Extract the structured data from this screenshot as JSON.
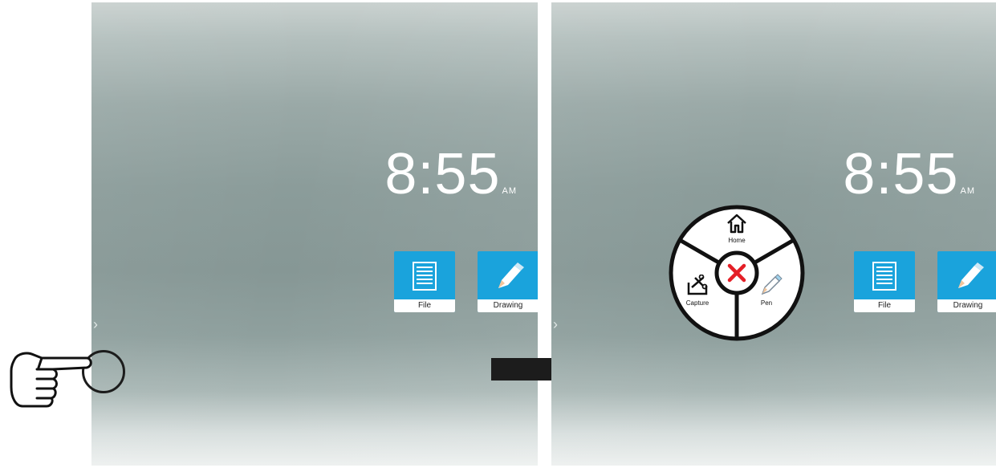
{
  "before": {
    "clock": {
      "time": "8:55",
      "ampm": "AM"
    },
    "tiles": [
      {
        "label": "File",
        "icon": "file-icon"
      },
      {
        "label": "Drawing",
        "icon": "pencil-icon"
      }
    ],
    "edge_chevron": "›"
  },
  "after": {
    "clock": {
      "time": "8:55",
      "ampm": "AM"
    },
    "tiles": [
      {
        "label": "File",
        "icon": "file-icon"
      },
      {
        "label": "Drawing",
        "icon": "pencil-icon"
      }
    ],
    "edge_chevron": "›",
    "radial_menu": {
      "items": [
        {
          "label": "Home",
          "icon": "home-icon"
        },
        {
          "label": "Capture",
          "icon": "capture-icon"
        },
        {
          "label": "Pen",
          "icon": "pen-icon"
        }
      ],
      "close_icon": "close-icon"
    }
  },
  "colors": {
    "tile_blue": "#1aa3dc",
    "close_red": "#e41e26"
  }
}
